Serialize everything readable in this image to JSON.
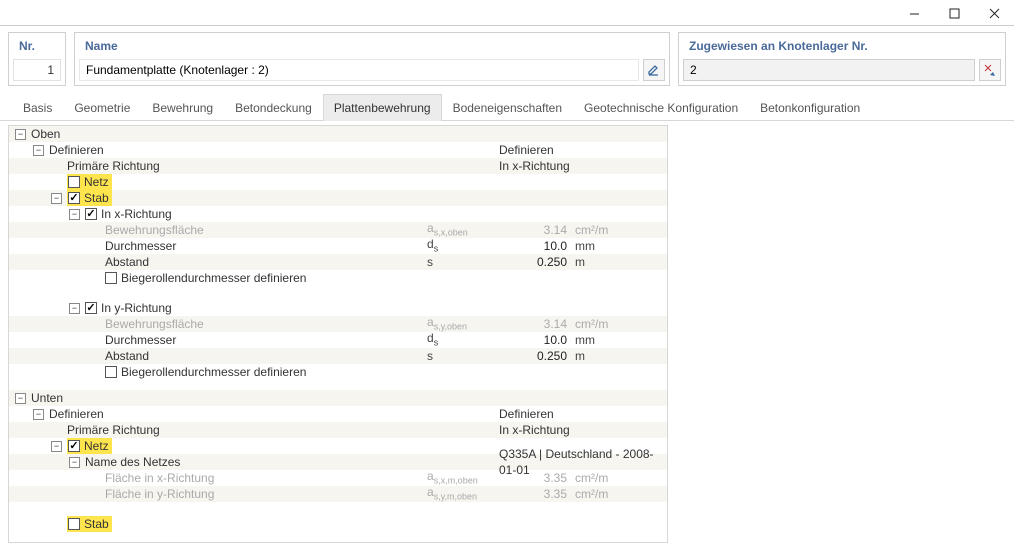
{
  "window": {
    "minimize": "–",
    "maximize": "▢",
    "close": "✕"
  },
  "header": {
    "nr": {
      "label": "Nr.",
      "value": "1"
    },
    "name": {
      "label": "Name",
      "value": "Fundamentplatte (Knotenlager : 2)"
    },
    "zuw": {
      "label": "Zugewiesen an Knotenlager Nr.",
      "value": "2"
    }
  },
  "tabs": {
    "basis": "Basis",
    "geometrie": "Geometrie",
    "bewehrung": "Bewehrung",
    "betondeckung": "Betondeckung",
    "plattenbewehrung": "Plattenbewehrung",
    "bodeneigenschaften": "Bodeneigenschaften",
    "geotech": "Geotechnische Konfiguration",
    "betonkonfig": "Betonkonfiguration"
  },
  "top": {
    "oben": "Oben",
    "definieren": "Definieren",
    "definieren2": "Definieren",
    "primaer": "Primäre Richtung",
    "inx": "In x-Richtung",
    "netz": "Netz",
    "stab": "Stab",
    "inxr": "In x-Richtung",
    "bew": "Bewehrungsfläche",
    "sym_ax": "a",
    "sym_ax_sub": "s,x,oben",
    "val_ax": "3.14",
    "unit_ax": "cm²/m",
    "durch": "Durchmesser",
    "sym_d": "d",
    "sym_d_sub": "s",
    "val_d": "10.0",
    "unit_d": "mm",
    "abst": "Abstand",
    "sym_s": "s",
    "val_s": "0.250",
    "unit_s": "m",
    "biege": "Biegerollendurchmesser definieren",
    "inyr": "In y-Richtung",
    "sym_ay": "a",
    "sym_ay_sub": "s,y,oben",
    "val_ay": "3.14",
    "unit_ay": "cm²/m",
    "val_dy": "10.0",
    "unit_dy": "mm",
    "val_sy": "0.250",
    "unit_sy": "m"
  },
  "bottom": {
    "unten": "Unten",
    "definieren": "Definieren",
    "definieren2": "Definieren",
    "primaer": "Primäre Richtung",
    "inx": "In x-Richtung",
    "netz": "Netz",
    "namenetz": "Name des Netzes",
    "netzval": "Q335A | Deutschland - 2008-01-01",
    "flx": "Fläche in x-Richtung",
    "sym_fx": "a",
    "sym_fx_sub": "s,x,m,oben",
    "val_fx": "3.35",
    "unit_fx": "cm²/m",
    "fly": "Fläche in y-Richtung",
    "sym_fy": "a",
    "sym_fy_sub": "s,y,m,oben",
    "val_fy": "3.35",
    "unit_fy": "cm²/m",
    "stab": "Stab"
  }
}
